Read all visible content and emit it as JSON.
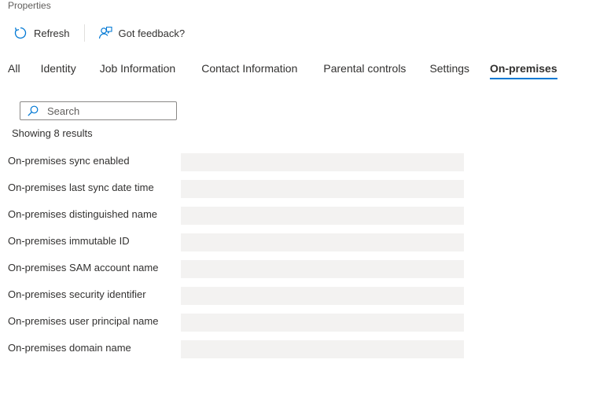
{
  "title": "Properties",
  "toolbar": {
    "refresh_label": "Refresh",
    "feedback_label": "Got feedback?"
  },
  "tabs": [
    {
      "label": "All",
      "active": false
    },
    {
      "label": "Identity",
      "active": false
    },
    {
      "label": "Job Information",
      "active": false
    },
    {
      "label": "Contact Information",
      "active": false
    },
    {
      "label": "Parental controls",
      "active": false
    },
    {
      "label": "Settings",
      "active": false
    },
    {
      "label": "On-premises",
      "active": true
    }
  ],
  "search": {
    "placeholder": "Search",
    "value": ""
  },
  "results_text": "Showing 8 results",
  "properties": [
    {
      "label": "On-premises sync enabled",
      "value": ""
    },
    {
      "label": "On-premises last sync date time",
      "value": ""
    },
    {
      "label": "On-premises distinguished name",
      "value": ""
    },
    {
      "label": "On-premises immutable ID",
      "value": ""
    },
    {
      "label": "On-premises SAM account name",
      "value": ""
    },
    {
      "label": "On-premises security identifier",
      "value": ""
    },
    {
      "label": "On-premises user principal name",
      "value": ""
    },
    {
      "label": "On-premises domain name",
      "value": ""
    }
  ],
  "icons": {
    "refresh": "refresh-icon",
    "feedback": "feedback-icon",
    "search": "search-icon"
  },
  "colors": {
    "accent": "#0078d4",
    "placeholder_fill": "#f3f2f1",
    "text": "#323130"
  }
}
